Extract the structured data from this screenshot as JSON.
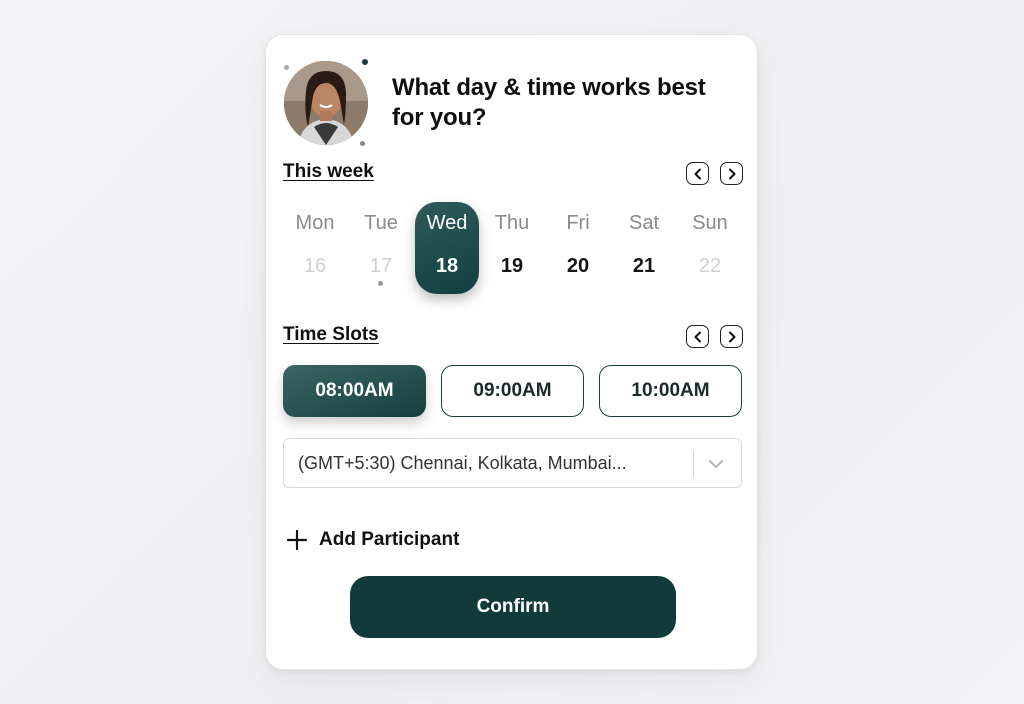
{
  "heading": "What day & time works best for you?",
  "week": {
    "title": "This week",
    "prev_icon": "chevron-left-icon",
    "next_icon": "chevron-right-icon",
    "days": [
      {
        "name": "Mon",
        "date": "16",
        "state": "disabled"
      },
      {
        "name": "Tue",
        "date": "17",
        "state": "disabled",
        "marker": true
      },
      {
        "name": "Wed",
        "date": "18",
        "state": "selected"
      },
      {
        "name": "Thu",
        "date": "19",
        "state": "available"
      },
      {
        "name": "Fri",
        "date": "20",
        "state": "available"
      },
      {
        "name": "Sat",
        "date": "21",
        "state": "available"
      },
      {
        "name": "Sun",
        "date": "22",
        "state": "disabled"
      }
    ]
  },
  "slots": {
    "title": "Time Slots",
    "prev_icon": "chevron-left-icon",
    "next_icon": "chevron-right-icon",
    "items": [
      {
        "label": "08:00AM",
        "selected": true
      },
      {
        "label": "09:00AM",
        "selected": false
      },
      {
        "label": "10:00AM",
        "selected": false
      }
    ]
  },
  "timezone": {
    "value": "(GMT+5:30) Chennai, Kolkata, Mumbai...",
    "icon": "chevron-down-icon"
  },
  "add_participant": {
    "label": "Add Participant",
    "icon": "plus-icon"
  },
  "confirm": {
    "label": "Confirm"
  },
  "colors": {
    "accent": "#113b3b",
    "accent_light": "#2e5a5a",
    "disabled_text": "#cfcfcf",
    "muted_text": "#8a8a8a"
  }
}
